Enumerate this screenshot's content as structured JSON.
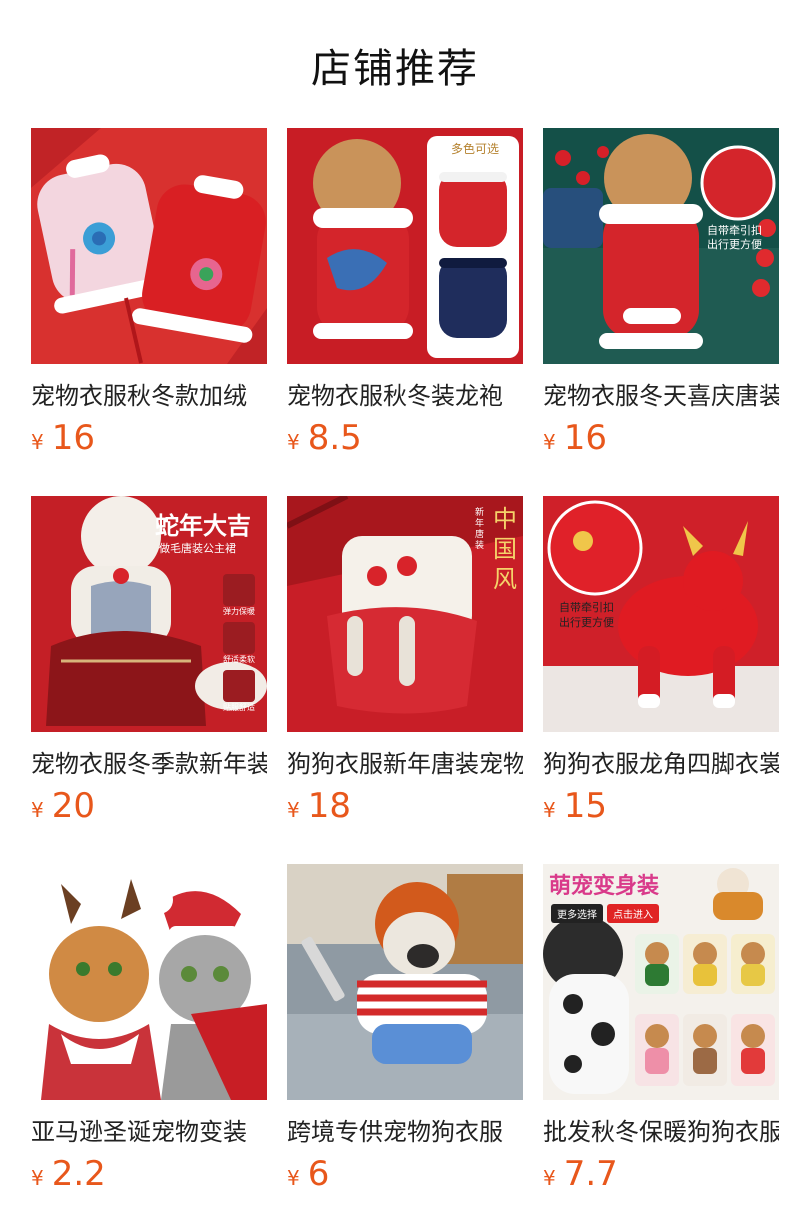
{
  "header": {
    "title": "店铺推荐"
  },
  "colors": {
    "price": "#e8571b",
    "brand_red": "#d42a2a"
  },
  "products": [
    {
      "name": "宠物衣服秋冬款加绒",
      "currency": "¥",
      "price": "16",
      "image": "pink-and-red-embroidered-cheongsam-image"
    },
    {
      "name": "宠物衣服秋冬装龙袍",
      "currency": "¥",
      "price": "8.5",
      "image": "dragon-robe-dog-image",
      "badge": "多色可选"
    },
    {
      "name": "宠物衣服冬天喜庆唐装",
      "currency": "¥",
      "price": "16",
      "image": "festive-tang-suit-dog-image",
      "badge": "自带牵引扣\n出行更方便"
    },
    {
      "name": "宠物衣服冬季款新年装",
      "currency": "¥",
      "price": "20",
      "image": "snake-year-princess-dress-image",
      "badge": "蛇年大吉",
      "sub": "做毛唐装公主裙",
      "features": [
        "弹力保暖",
        "舒适柔软",
        "贴服舒适"
      ]
    },
    {
      "name": "狗狗衣服新年唐装宠物",
      "currency": "¥",
      "price": "18",
      "image": "chinese-style-dress-image",
      "badge": "中国风",
      "sub": "新年唐装"
    },
    {
      "name": "狗狗衣服龙角四脚衣裳",
      "currency": "¥",
      "price": "15",
      "image": "red-dragon-costume-dog-image",
      "badge": "自带牵引扣\n出行更方便"
    },
    {
      "name": "亚马逊圣诞宠物变装",
      "currency": "¥",
      "price": "2.2",
      "image": "christmas-cats-image"
    },
    {
      "name": "跨境专供宠物狗衣服",
      "currency": "¥",
      "price": "6",
      "image": "chucky-costume-bulldog-image"
    },
    {
      "name": "批发秋冬保暖狗狗衣服",
      "currency": "¥",
      "price": "7.7",
      "image": "cute-transform-costumes-image",
      "badge": "萌宠变身装",
      "buttons": [
        "更多选择",
        "点击进入"
      ]
    }
  ]
}
